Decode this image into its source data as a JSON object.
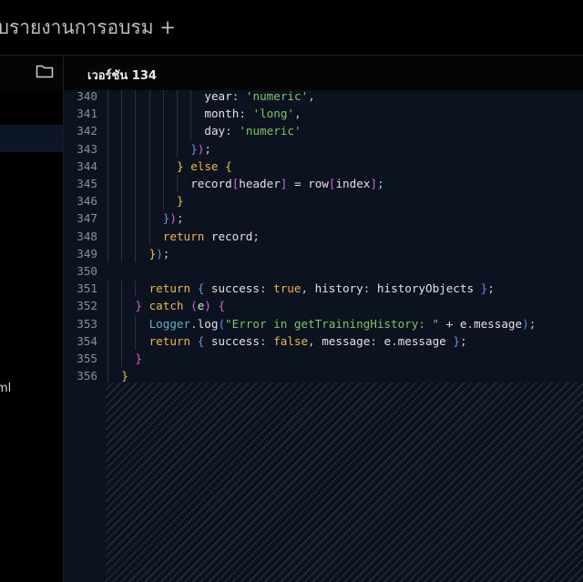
{
  "app": {
    "title": "ะบบรายงานการอบรม +"
  },
  "tabs": {
    "folder_icon": "folder-icon",
    "active_version": "เวอร์ชัน 134"
  },
  "sidebar": {
    "visible_file_fragment": "ml"
  },
  "editor": {
    "lines": [
      {
        "n": "340",
        "indent": 7,
        "tokens": [
          [
            "t",
            "year"
          ],
          [
            "p",
            ": "
          ],
          [
            "s",
            "'numeric'"
          ],
          [
            "p",
            ","
          ]
        ]
      },
      {
        "n": "341",
        "indent": 7,
        "tokens": [
          [
            "t",
            "month"
          ],
          [
            "p",
            ": "
          ],
          [
            "s",
            "'long'"
          ],
          [
            "p",
            ","
          ]
        ]
      },
      {
        "n": "342",
        "indent": 7,
        "tokens": [
          [
            "t",
            "day"
          ],
          [
            "p",
            ": "
          ],
          [
            "s",
            "'numeric'"
          ]
        ]
      },
      {
        "n": "343",
        "indent": 6,
        "tokens": [
          [
            "b2",
            "}"
          ],
          [
            "b1",
            ")"
          ],
          [
            "p",
            ";"
          ]
        ]
      },
      {
        "n": "344",
        "indent": 5,
        "tokens": [
          [
            "b3",
            "}"
          ],
          [
            "t",
            " "
          ],
          [
            "k",
            "else"
          ],
          [
            "t",
            " "
          ],
          [
            "b3",
            "{"
          ]
        ]
      },
      {
        "n": "345",
        "indent": 6,
        "tokens": [
          [
            "t",
            "record"
          ],
          [
            "b1",
            "["
          ],
          [
            "t",
            "header"
          ],
          [
            "b1",
            "]"
          ],
          [
            "t",
            " = row"
          ],
          [
            "b1",
            "["
          ],
          [
            "t",
            "index"
          ],
          [
            "b1",
            "]"
          ],
          [
            "p",
            ";"
          ]
        ]
      },
      {
        "n": "346",
        "indent": 5,
        "tokens": [
          [
            "b3",
            "}"
          ]
        ]
      },
      {
        "n": "347",
        "indent": 4,
        "tokens": [
          [
            "b2",
            "}"
          ],
          [
            "b1",
            ")"
          ],
          [
            "p",
            ";"
          ]
        ]
      },
      {
        "n": "348",
        "indent": 4,
        "tokens": [
          [
            "k",
            "return"
          ],
          [
            "t",
            " record"
          ],
          [
            "p",
            ";"
          ]
        ]
      },
      {
        "n": "349",
        "indent": 3,
        "tokens": [
          [
            "b3",
            "}"
          ],
          [
            "b2",
            ")"
          ],
          [
            "p",
            ";"
          ]
        ]
      },
      {
        "n": "350",
        "indent": 0,
        "tokens": []
      },
      {
        "n": "351",
        "indent": 3,
        "tokens": [
          [
            "k",
            "return"
          ],
          [
            "t",
            " "
          ],
          [
            "b2",
            "{"
          ],
          [
            "t",
            " success"
          ],
          [
            "p",
            ": "
          ],
          [
            "k",
            "true"
          ],
          [
            "p",
            ","
          ],
          [
            "t",
            " history"
          ],
          [
            "p",
            ": "
          ],
          [
            "t",
            "historyObjects "
          ],
          [
            "b2",
            "}"
          ],
          [
            "p",
            ";"
          ]
        ]
      },
      {
        "n": "352",
        "indent": 2,
        "tokens": [
          [
            "b1",
            "}"
          ],
          [
            "t",
            " "
          ],
          [
            "k",
            "catch"
          ],
          [
            "t",
            " "
          ],
          [
            "b1",
            "("
          ],
          [
            "t",
            "e"
          ],
          [
            "b1",
            ")"
          ],
          [
            "t",
            " "
          ],
          [
            "b1",
            "{"
          ]
        ]
      },
      {
        "n": "353",
        "indent": 3,
        "tokens": [
          [
            "f",
            "Logger"
          ],
          [
            "p",
            "."
          ],
          [
            "t",
            "log"
          ],
          [
            "b2",
            "("
          ],
          [
            "s",
            "\"Error in getTrainingHistory: \""
          ],
          [
            "t",
            " + e"
          ],
          [
            "p",
            "."
          ],
          [
            "t",
            "message"
          ],
          [
            "b2",
            ")"
          ],
          [
            "p",
            ";"
          ]
        ]
      },
      {
        "n": "354",
        "indent": 3,
        "tokens": [
          [
            "k",
            "return"
          ],
          [
            "t",
            " "
          ],
          [
            "b2",
            "{"
          ],
          [
            "t",
            " success"
          ],
          [
            "p",
            ": "
          ],
          [
            "k",
            "false"
          ],
          [
            "p",
            ","
          ],
          [
            "t",
            " message"
          ],
          [
            "p",
            ": "
          ],
          [
            "t",
            "e"
          ],
          [
            "p",
            "."
          ],
          [
            "t",
            "message "
          ],
          [
            "b2",
            "}"
          ],
          [
            "p",
            ";"
          ]
        ]
      },
      {
        "n": "355",
        "indent": 2,
        "tokens": [
          [
            "b1",
            "}"
          ]
        ]
      },
      {
        "n": "356",
        "indent": 1,
        "tokens": [
          [
            "b3",
            "}"
          ]
        ]
      }
    ]
  },
  "colors": {
    "editor_bg": "#0d1220",
    "string": "#7dc561",
    "keyword": "#e9b94a",
    "bracket_magenta": "#d466c7",
    "bracket_blue": "#5a96e6",
    "bracket_yellow": "#e9c545"
  }
}
